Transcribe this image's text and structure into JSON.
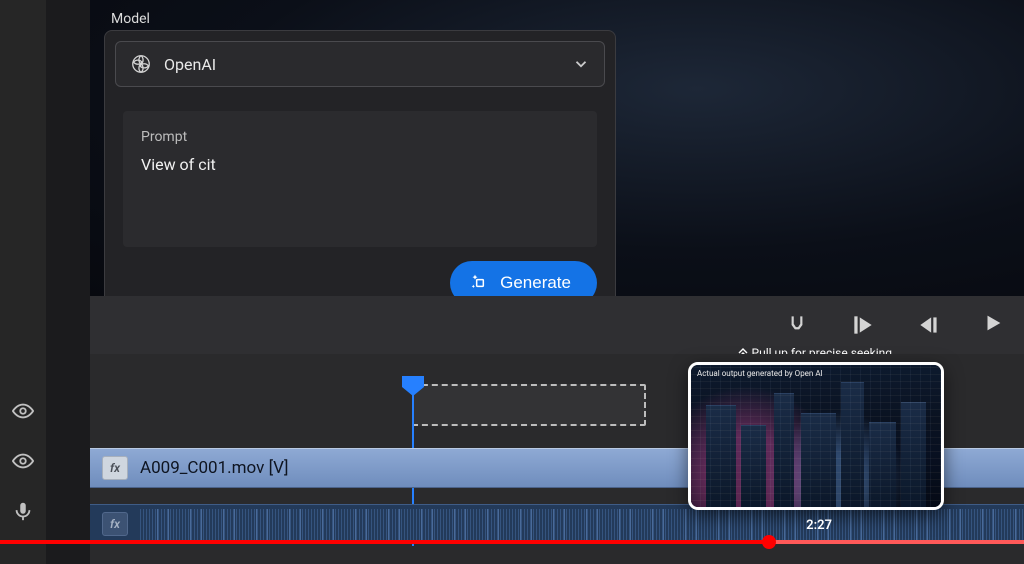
{
  "panel": {
    "model_label": "Model",
    "model_selected": "OpenAI",
    "prompt_label": "Prompt",
    "prompt_value": "View of cit",
    "generate_label": "Generate"
  },
  "controls": {
    "pull_up_hint": "Pull up for precise seeking"
  },
  "timeline": {
    "video_clip_name": "A009_C001.mov [V]",
    "fx_badge": "fx"
  },
  "thumbnail": {
    "caption": "Actual output generated by Open AI",
    "time": "2:27"
  }
}
